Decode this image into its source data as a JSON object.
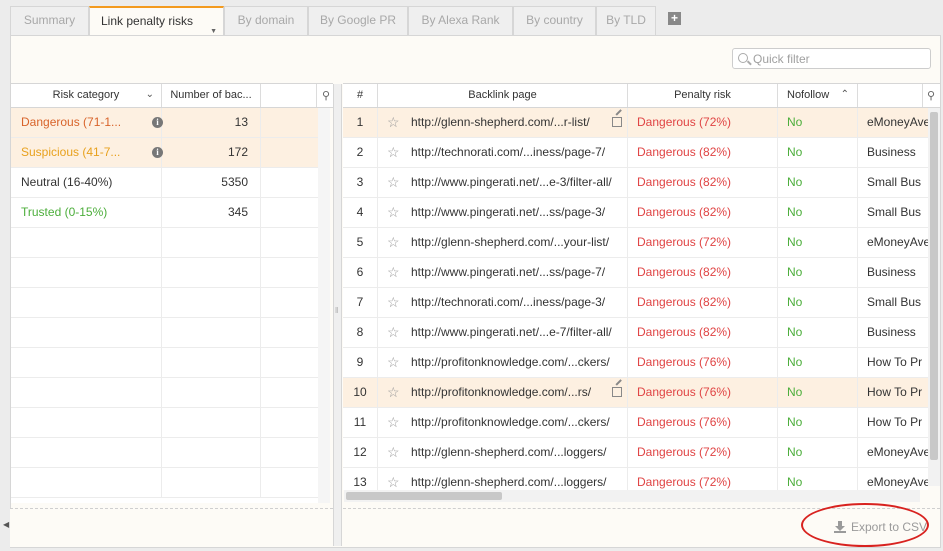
{
  "tabs": [
    {
      "label": "Summary",
      "active": false
    },
    {
      "label": "Link penalty risks",
      "active": true
    },
    {
      "label": "By domain",
      "active": false
    },
    {
      "label": "By Google PR",
      "active": false
    },
    {
      "label": "By Alexa Rank",
      "active": false
    },
    {
      "label": "By country",
      "active": false
    },
    {
      "label": "By TLD",
      "active": false
    }
  ],
  "quick_filter": {
    "placeholder": "Quick filter",
    "value": ""
  },
  "left_table": {
    "headers": {
      "risk_category": "Risk category",
      "number_of_backlinks": "Number of bac..."
    },
    "rows": [
      {
        "category": "Dangerous (71-1...",
        "count": "13",
        "color": "#d8632a",
        "info": true
      },
      {
        "category": "Suspicious (41-7...",
        "count": "172",
        "color": "#e8a11d",
        "info": true
      },
      {
        "category": "Neutral (16-40%)",
        "count": "5350",
        "color": "#333333",
        "info": false
      },
      {
        "category": "Trusted (0-15%)",
        "count": "345",
        "color": "#4cae3b",
        "info": false
      }
    ]
  },
  "right_table": {
    "headers": {
      "num": "#",
      "backlink_page": "Backlink page",
      "penalty_risk": "Penalty risk",
      "nofollow": "Nofollow"
    },
    "rows": [
      {
        "num": "1",
        "url": "http://glenn-shepherd.com/...r-list/",
        "risk": "Dangerous (72%)",
        "nofollow": "No",
        "extra": "eMoneyAve"
      },
      {
        "num": "2",
        "url": "http://technorati.com/...iness/page-7/",
        "risk": "Dangerous (82%)",
        "nofollow": "No",
        "extra": "Business"
      },
      {
        "num": "3",
        "url": "http://www.pingerati.net/...e-3/filter-all/",
        "risk": "Dangerous (82%)",
        "nofollow": "No",
        "extra": "Small Bus"
      },
      {
        "num": "4",
        "url": "http://www.pingerati.net/...ss/page-3/",
        "risk": "Dangerous (82%)",
        "nofollow": "No",
        "extra": "Small Bus"
      },
      {
        "num": "5",
        "url": "http://glenn-shepherd.com/...your-list/",
        "risk": "Dangerous (72%)",
        "nofollow": "No",
        "extra": "eMoneyAve"
      },
      {
        "num": "6",
        "url": "http://www.pingerati.net/...ss/page-7/",
        "risk": "Dangerous (82%)",
        "nofollow": "No",
        "extra": "Business"
      },
      {
        "num": "7",
        "url": "http://technorati.com/...iness/page-3/",
        "risk": "Dangerous (82%)",
        "nofollow": "No",
        "extra": "Small Bus"
      },
      {
        "num": "8",
        "url": "http://www.pingerati.net/...e-7/filter-all/",
        "risk": "Dangerous (82%)",
        "nofollow": "No",
        "extra": "Business"
      },
      {
        "num": "9",
        "url": "http://profitonknowledge.com/...ckers/",
        "risk": "Dangerous (76%)",
        "nofollow": "No",
        "extra": "How To Pr"
      },
      {
        "num": "10",
        "url": "http://profitonknowledge.com/...rs/",
        "risk": "Dangerous (76%)",
        "nofollow": "No",
        "extra": "How To Pr"
      },
      {
        "num": "11",
        "url": "http://profitonknowledge.com/...ckers/",
        "risk": "Dangerous (76%)",
        "nofollow": "No",
        "extra": "How To Pr"
      },
      {
        "num": "12",
        "url": "http://glenn-shepherd.com/...loggers/",
        "risk": "Dangerous (72%)",
        "nofollow": "No",
        "extra": "eMoneyAve"
      },
      {
        "num": "13",
        "url": "http://glenn-shepherd.com/...loggers/",
        "risk": "Dangerous (72%)",
        "nofollow": "No",
        "extra": "eMoneyAve"
      }
    ]
  },
  "footer": {
    "export_label": "Export to CSV"
  },
  "colors": {
    "accent": "#f39a1e",
    "danger": "#e04444",
    "nofollow_no": "#4cae3b",
    "highlight": "#d8221f"
  }
}
